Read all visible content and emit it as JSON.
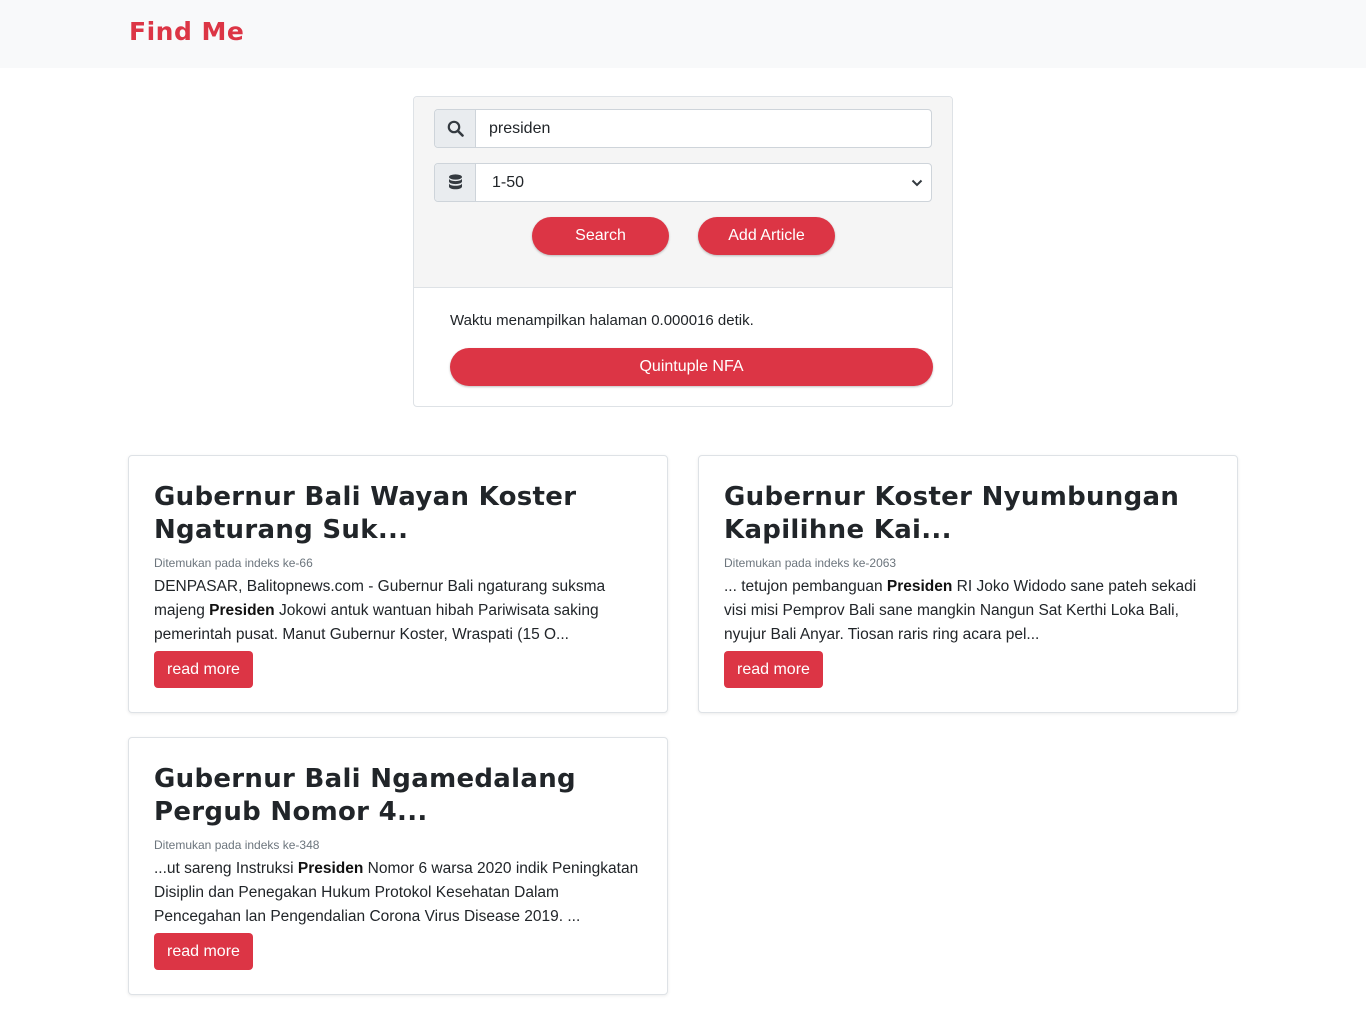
{
  "nav": {
    "brand": "Find Me"
  },
  "search": {
    "icon": "search-icon",
    "query": "presiden",
    "range_icon": "database-icon",
    "range_selected": "1-50",
    "search_label": "Search",
    "add_label": "Add Article",
    "timing_text": "Waktu menampilkan halaman 0.000016 detik.",
    "nfa_label": "Quintuple NFA"
  },
  "colors": {
    "accent": "#dc3545",
    "navbar_bg": "#f8f9fa",
    "panel_bg": "#f5f5f5"
  },
  "results": [
    {
      "title": "Gubernur Bali Wayan Koster Ngaturang Suk...",
      "index_text": "Ditemukan pada indeks ke-66",
      "snippet_before": "DENPASAR, Balitopnews.com - Gubernur Bali ngaturang suksma majeng ",
      "snippet_highlight": "Presiden",
      "snippet_after": " Jokowi antuk wantuan hibah Pariwisata saking pemerintah pusat. Manut Gubernur Koster, Wraspati (15 O...",
      "read_more": "read more"
    },
    {
      "title": "Gubernur Koster Nyumbungan Kapilihne Kai...",
      "index_text": "Ditemukan pada indeks ke-2063",
      "snippet_before": "... tetujon pembanguan ",
      "snippet_highlight": "Presiden",
      "snippet_after": " RI Joko Widodo sane pateh sekadi visi misi Pemprov Bali sane mangkin Nangun Sat Kerthi Loka Bali, nyujur Bali Anyar. Tiosan raris ring acara pel...",
      "read_more": "read more"
    },
    {
      "title": "Gubernur Bali Ngamedalang Pergub Nomor 4...",
      "index_text": "Ditemukan pada indeks ke-348",
      "snippet_before": "...ut sareng Instruksi ",
      "snippet_highlight": "Presiden",
      "snippet_after": " Nomor 6 warsa 2020 indik Peningkatan Disiplin dan Penegakan Hukum Protokol Kesehatan Dalam Pencegahan lan Pengendalian Corona Virus Disease 2019. ...",
      "read_more": "read more"
    }
  ]
}
